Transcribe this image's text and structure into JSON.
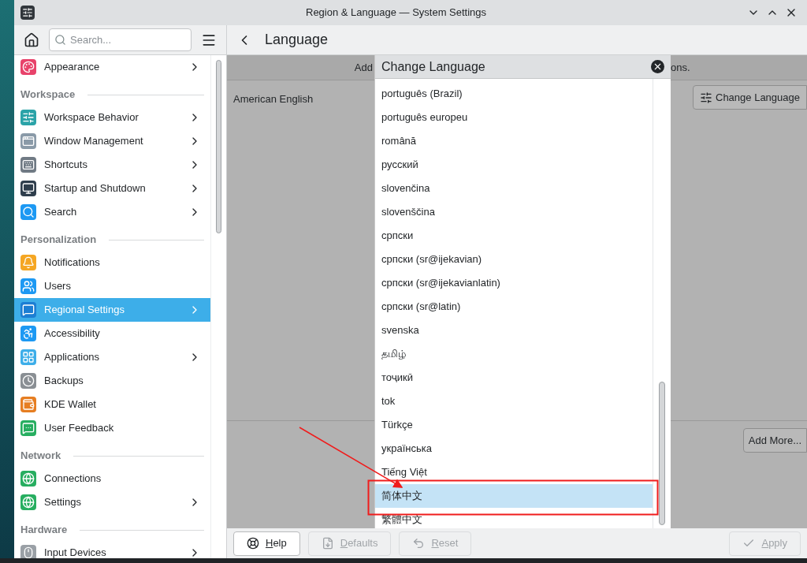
{
  "window": {
    "title": "Region & Language — System Settings"
  },
  "toolbar": {
    "search_placeholder": "Search...",
    "page_title": "Language"
  },
  "sidebar": {
    "sections": [
      {
        "items": [
          {
            "label": "Appearance",
            "expandable": true,
            "selected": false
          }
        ]
      },
      {
        "header": "Workspace",
        "items": [
          {
            "label": "Workspace Behavior",
            "expandable": true,
            "selected": false
          },
          {
            "label": "Window Management",
            "expandable": true,
            "selected": false
          },
          {
            "label": "Shortcuts",
            "expandable": true,
            "selected": false
          },
          {
            "label": "Startup and Shutdown",
            "expandable": true,
            "selected": false
          },
          {
            "label": "Search",
            "expandable": true,
            "selected": false
          }
        ]
      },
      {
        "header": "Personalization",
        "items": [
          {
            "label": "Notifications",
            "expandable": false,
            "selected": false
          },
          {
            "label": "Users",
            "expandable": false,
            "selected": false
          },
          {
            "label": "Regional Settings",
            "expandable": true,
            "selected": true
          },
          {
            "label": "Accessibility",
            "expandable": false,
            "selected": false
          },
          {
            "label": "Applications",
            "expandable": true,
            "selected": false
          },
          {
            "label": "Backups",
            "expandable": false,
            "selected": false
          },
          {
            "label": "KDE Wallet",
            "expandable": false,
            "selected": false
          },
          {
            "label": "User Feedback",
            "expandable": false,
            "selected": false
          }
        ]
      },
      {
        "header": "Network",
        "items": [
          {
            "label": "Connections",
            "expandable": false,
            "selected": false
          },
          {
            "label": "Settings",
            "expandable": true,
            "selected": false
          }
        ]
      },
      {
        "header": "Hardware",
        "items": [
          {
            "label": "Input Devices",
            "expandable": true,
            "selected": false
          }
        ]
      }
    ]
  },
  "content": {
    "header_left": "Add",
    "header_right": "ons.",
    "languages": [
      "American English"
    ],
    "change_language_button": "Change Language",
    "add_more_button": "Add More..."
  },
  "dialog": {
    "title": "Change Language",
    "items": [
      {
        "label": "português (Brazil)",
        "selected": false
      },
      {
        "label": "português europeu",
        "selected": false
      },
      {
        "label": "română",
        "selected": false
      },
      {
        "label": "русский",
        "selected": false
      },
      {
        "label": "slovenčina",
        "selected": false
      },
      {
        "label": "slovenščina",
        "selected": false
      },
      {
        "label": "српски",
        "selected": false
      },
      {
        "label": "српски (sr@ijekavian)",
        "selected": false
      },
      {
        "label": "српски (sr@ijekavianlatin)",
        "selected": false
      },
      {
        "label": "српски (sr@latin)",
        "selected": false
      },
      {
        "label": "svenska",
        "selected": false
      },
      {
        "label": "தமிழ்",
        "selected": false
      },
      {
        "label": "тоҷикӣ",
        "selected": false
      },
      {
        "label": "tok",
        "selected": false
      },
      {
        "label": "Türkçe",
        "selected": false
      },
      {
        "label": "українська",
        "selected": false
      },
      {
        "label": "Tiếng Việt",
        "selected": false
      },
      {
        "label": "简体中文",
        "selected": true
      },
      {
        "label": "繁體中文",
        "selected": false
      }
    ]
  },
  "bottom_buttons": [
    {
      "label": "Help",
      "disabled": false
    },
    {
      "label": "Defaults",
      "disabled": true
    },
    {
      "label": "Reset",
      "disabled": true
    },
    {
      "label": "Apply",
      "disabled": true
    }
  ]
}
